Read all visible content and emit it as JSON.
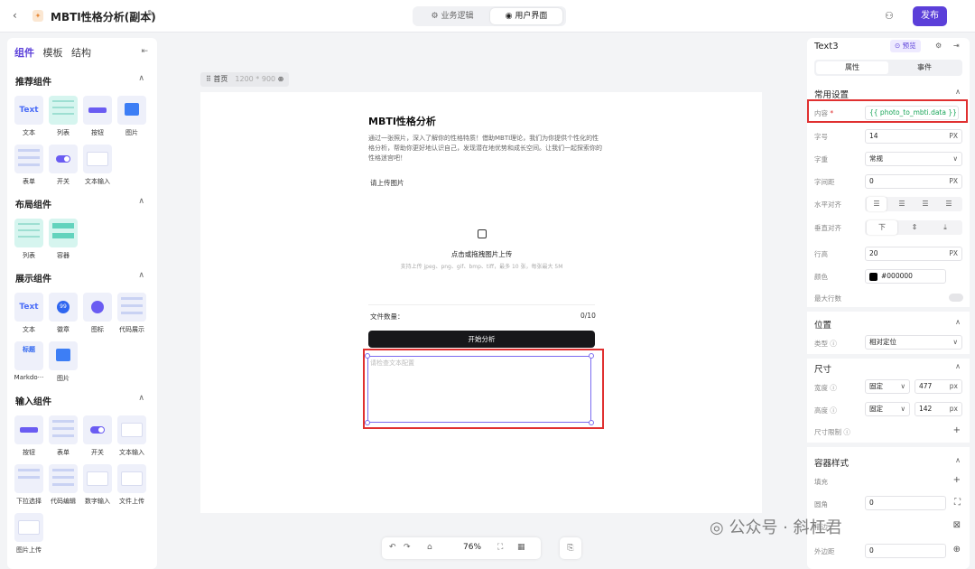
{
  "topbar": {
    "title": "MBTI性格分析(副本)",
    "tabs": [
      "业务逻辑",
      "用户界面"
    ],
    "active_tab": "用户界面",
    "publish": "发布"
  },
  "left": {
    "tabs": [
      "组件",
      "模板",
      "结构"
    ],
    "sections": {
      "recommended": {
        "title": "推荐组件",
        "items": [
          "文本",
          "列表",
          "按钮",
          "图片",
          "表单",
          "开关",
          "文本输入"
        ]
      },
      "layout": {
        "title": "布局组件",
        "items": [
          "列表",
          "容器"
        ]
      },
      "display": {
        "title": "展示组件",
        "items": [
          "文本",
          "徽章",
          "图标",
          "代码展示",
          "Markdo···",
          "图片"
        ]
      },
      "input": {
        "title": "输入组件",
        "items": [
          "按钮",
          "表单",
          "开关",
          "文本输入",
          "下拉选择",
          "代码编辑",
          "数字输入",
          "文件上传",
          "图片上传"
        ]
      }
    },
    "thumb_text": "Text",
    "thumb_badge": "99",
    "thumb_md": "标题"
  },
  "canvas": {
    "crumb": "首页",
    "size": "1200 * 900",
    "page": {
      "title": "MBTI性格分析",
      "desc": "通过一张照片，深入了解你的性格特质！借助MBTI理论，我们为你提供个性化的性格分析，帮助你更好地认识自己，发现潜在地优势和成长空间。让我们一起探索你的性格迷宫吧！",
      "upload_label": "请上传图片",
      "upload_text": "点击或拖拽图片上传",
      "upload_hint": "支持上传 jpeg、png、gif、bmp、tiff，最多 10 张，每张最大 5M",
      "file_count_label": "文件数量：",
      "file_count_value": "0/10",
      "start_button": "开始分析",
      "text_placeholder": "请检查文本配置"
    },
    "zoom": "76%"
  },
  "right": {
    "component": "Text3",
    "preview": "预览",
    "tabs": [
      "属性",
      "事件"
    ],
    "common_title": "常用设置",
    "props": {
      "content_label": "内容",
      "content_value": "{{ photo_to_mbti.data }}",
      "font_size_label": "字号",
      "font_size": "14",
      "font_weight_label": "字重",
      "font_weight": "常规",
      "letter_spacing_label": "字间距",
      "letter_spacing": "0",
      "halign_label": "水平对齐",
      "valign_label": "垂直对齐",
      "valign_top": "下",
      "line_height_label": "行高",
      "line_height": "20",
      "color_label": "颜色",
      "color": "#000000",
      "max_lines_label": "最大行数"
    },
    "unit_px": "PX",
    "position_title": "位置",
    "position_type_label": "类型",
    "position_type": "相对定位",
    "size_title": "尺寸",
    "width_label": "宽度",
    "width_mode": "固定",
    "width": "477",
    "height_label": "高度",
    "height_mode": "固定",
    "height": "142",
    "unit_px_lower": "px",
    "size_limit_label": "尺寸限制",
    "container_title": "容器样式",
    "fill_label": "填充",
    "radius_label": "圆角",
    "radius": "0",
    "border_label": "描边",
    "margin_label": "外边距",
    "margin": "0"
  },
  "watermark": "公众号 · 斜杠君",
  "colors": {
    "accent": "#5b3fd9",
    "highlight": "#e03030",
    "selection": "#7b6cf0"
  }
}
